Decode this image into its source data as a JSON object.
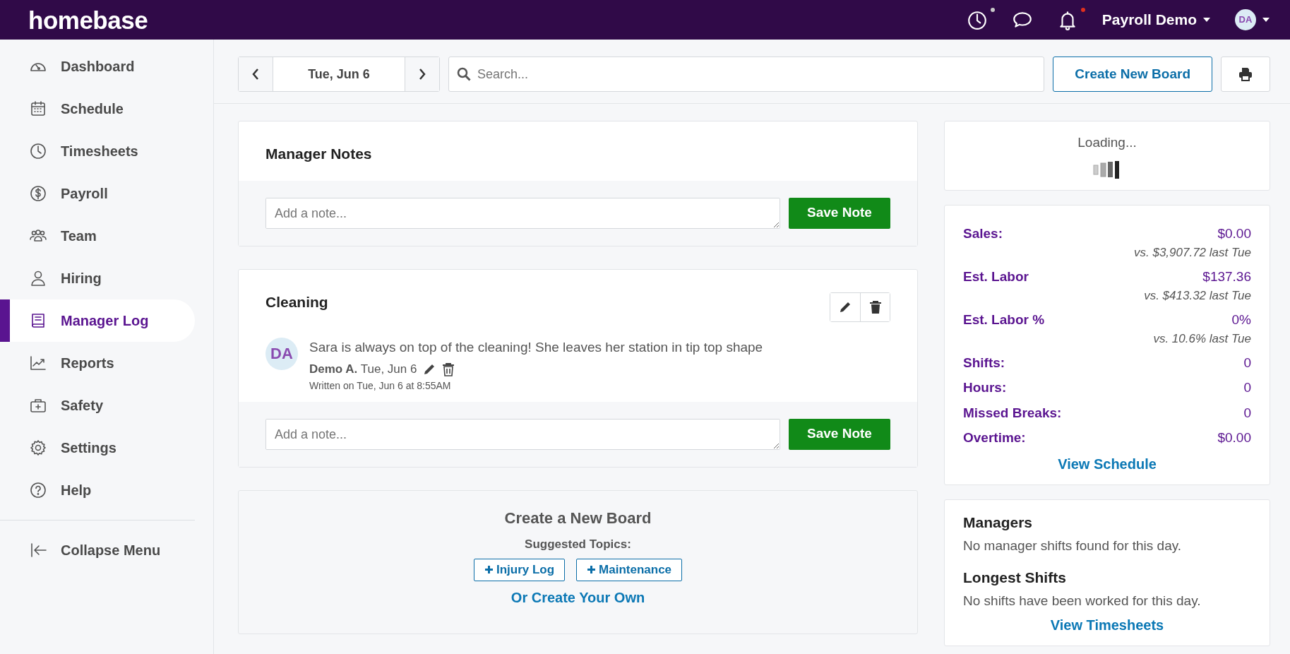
{
  "topbar": {
    "logo": "homebase",
    "icons": [
      {
        "kind": "clock",
        "color": "#c8c8c8"
      },
      {
        "kind": "chat"
      },
      {
        "kind": "bell",
        "color": "#e0301e"
      }
    ],
    "account": "Payroll Demo",
    "avatar": "DA"
  },
  "sidebar": {
    "items": [
      {
        "label": "Dashboard",
        "selected": false
      },
      {
        "label": "Schedule",
        "selected": false
      },
      {
        "label": "Timesheets",
        "selected": false
      },
      {
        "label": "Payroll",
        "selected": false
      },
      {
        "label": "Team",
        "selected": false
      },
      {
        "label": "Hiring",
        "selected": false
      },
      {
        "label": "Manager Log",
        "selected": true
      },
      {
        "label": "Reports",
        "selected": false
      },
      {
        "label": "Safety",
        "selected": false
      },
      {
        "label": "Settings",
        "selected": false
      },
      {
        "label": "Help",
        "selected": false
      }
    ],
    "collapse": "Collapse Menu"
  },
  "toolbar": {
    "date": "Tue, Jun 6",
    "search_placeholder": "Search...",
    "create_button": "Create New Board"
  },
  "boards": [
    {
      "title": "Manager Notes",
      "editable": false,
      "note_placeholder": "Add a note...",
      "save_button": "Save Note"
    },
    {
      "title": "Cleaning",
      "editable": true,
      "entries": [
        {
          "avatar": "DA",
          "text": "Sara is always on top of the cleaning! She leaves her station in tip top shape",
          "author": "Demo A.",
          "date": "Tue, Jun 6",
          "written": "Written on Tue, Jun 6 at 8:55AM"
        }
      ],
      "note_placeholder": "Add a note...",
      "save_button": "Save Note"
    }
  ],
  "create_board": {
    "title": "Create a New Board",
    "subtitle": "Suggested Topics:",
    "topics": [
      "Injury Log",
      "Maintenance"
    ],
    "link": "Or Create Your Own"
  },
  "loading": {
    "text": "Loading..."
  },
  "stats": [
    {
      "label": "Sales:",
      "value": "$0.00",
      "comparison": "vs. $3,907.72 last Tue"
    },
    {
      "label": "Est. Labor",
      "value": "$137.36",
      "comparison": "vs. $413.32 last Tue"
    },
    {
      "label": "Est. Labor %",
      "value": "0%",
      "comparison": "vs. 10.6% last Tue"
    },
    {
      "label": "Shifts:",
      "value": "0"
    },
    {
      "label": "Hours:",
      "value": "0"
    },
    {
      "label": "Missed Breaks:",
      "value": "0"
    },
    {
      "label": "Overtime:",
      "value": "$0.00"
    }
  ],
  "stats_link": "View Schedule",
  "info_sections": [
    {
      "title": "Managers",
      "text": "No manager shifts found for this day."
    },
    {
      "title": "Longest Shifts",
      "text": "No shifts have been worked for this day.",
      "link": "View Timesheets"
    }
  ]
}
